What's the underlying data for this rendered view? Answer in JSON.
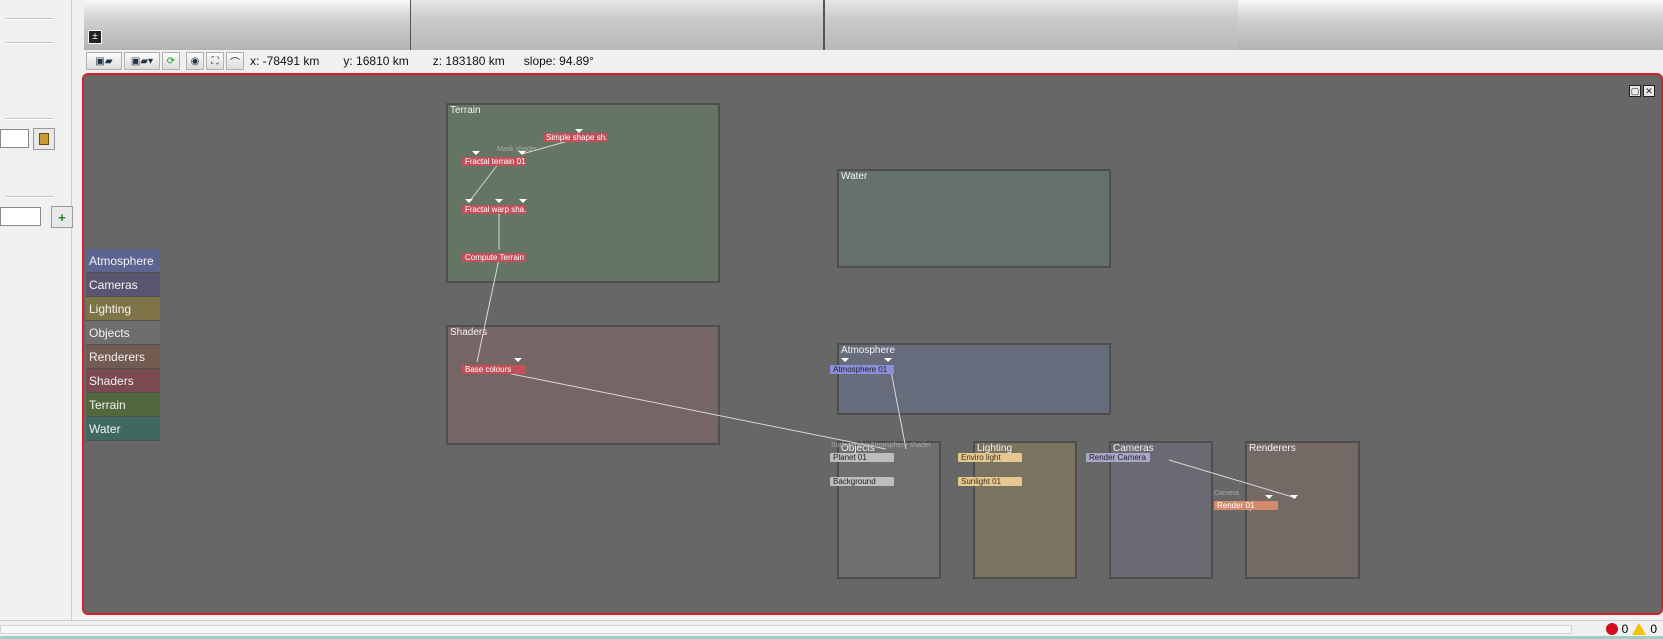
{
  "toolbar": {
    "readouts": {
      "x": "x: -78491 km",
      "y": "y: 16810 km",
      "z": "z: 183180 km",
      "slope": "slope: 94.89°"
    }
  },
  "categories": [
    {
      "label": "Atmosphere",
      "color": "#5c6590"
    },
    {
      "label": "Cameras",
      "color": "#5a5670"
    },
    {
      "label": "Lighting",
      "color": "#7f7448"
    },
    {
      "label": "Objects",
      "color": "#6e6e6e"
    },
    {
      "label": "Renderers",
      "color": "#725c52"
    },
    {
      "label": "Shaders",
      "color": "#7a4a50"
    },
    {
      "label": "Terrain",
      "color": "#50683c"
    },
    {
      "label": "Water",
      "color": "#3e6860"
    }
  ],
  "groups": {
    "terrain": {
      "title": "Terrain",
      "color": "#657563"
    },
    "water": {
      "title": "Water",
      "color": "#63706b"
    },
    "shaders": {
      "title": "Shaders",
      "color": "#766565"
    },
    "atmosphere": {
      "title": "Atmosphere",
      "color": "#676c7d"
    },
    "objects": {
      "title": "Objects",
      "color": "#6f6f6f"
    },
    "lighting": {
      "title": "Lighting",
      "color": "#79735f"
    },
    "cameras": {
      "title": "Cameras",
      "color": "#6b6a72"
    },
    "renderers": {
      "title": "Renderers",
      "color": "#756965"
    }
  },
  "nodes": {
    "simple_shape": "Simple shape sh...",
    "mask_shader": "Mask shader",
    "fractal_terrain": "Fractal terrain 01",
    "fractal_warp": "Fractal warp sha...",
    "compute_terrain": "Compute Terrain",
    "base_colours": "Base colours",
    "atmosphere_01": "Atmosphere 01",
    "surface_shader": "Surface sha...",
    "atmosphere_shader": "Atmosphere shader",
    "planet_01": "Planet 01",
    "background": "Background",
    "enviro_light": "Enviro light",
    "sunlight_01": "Sunlight 01",
    "render_camera": "Render Camera",
    "camera_label": "Camera",
    "render_01": "Render 01"
  },
  "status": {
    "errors": "0",
    "warnings": "0"
  }
}
